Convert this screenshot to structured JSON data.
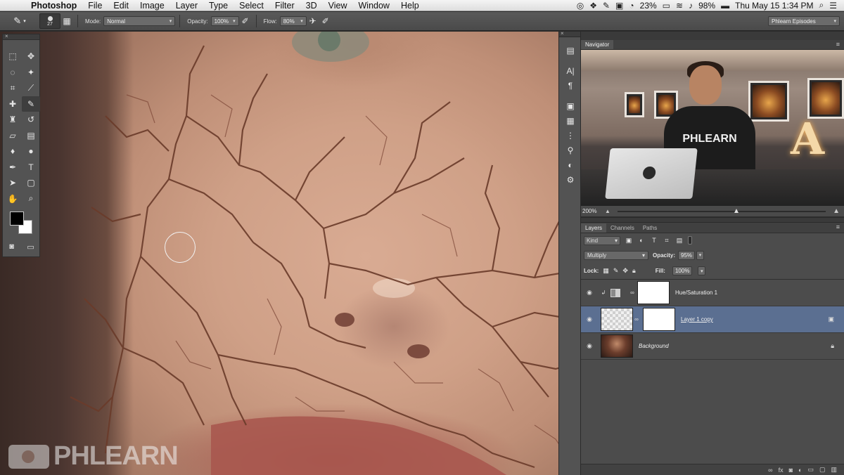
{
  "menubar": {
    "app_name": "Photoshop",
    "menus": [
      "File",
      "Edit",
      "Image",
      "Layer",
      "Type",
      "Select",
      "Filter",
      "3D",
      "View",
      "Window",
      "Help"
    ],
    "battery_small": "23%",
    "battery": "98%",
    "clock": "Thu May 15  1:34 PM",
    "icons": [
      "creative-cloud-icon",
      "dropbox-icon",
      "evernote-icon",
      "dashboard-icon",
      "battery-icon",
      "airplay-icon",
      "wifi-icon",
      "volume-icon",
      "battery-main-icon",
      "search-icon",
      "list-icon"
    ]
  },
  "options": {
    "brush_size": "27",
    "mode_label": "Mode:",
    "mode_value": "Normal",
    "opacity_label": "Opacity:",
    "opacity_value": "100%",
    "flow_label": "Flow:",
    "flow_value": "80%",
    "workspace": "Phlearn Episodes"
  },
  "navigator": {
    "tab": "Navigator",
    "zoom": "200%",
    "shirt_text": "PHLEARN",
    "sign_letter": "A"
  },
  "layers": {
    "tabs": [
      "Layers",
      "Channels",
      "Paths"
    ],
    "filter_kind": "Kind",
    "blend_mode": "Multiply",
    "opacity_label": "Opacity:",
    "opacity_value": "95%",
    "lock_label": "Lock:",
    "fill_label": "Fill:",
    "fill_value": "100%",
    "items": [
      {
        "name": "Hue/Saturation 1",
        "selected": false
      },
      {
        "name": "Layer 1 copy",
        "selected": true
      },
      {
        "name": "Background",
        "selected": false
      }
    ]
  },
  "watermark": "PHLEARN",
  "colors": {
    "selection": "#5b6f91",
    "panel_bg": "#4c4c4c",
    "toolbox_bg": "#535353"
  }
}
